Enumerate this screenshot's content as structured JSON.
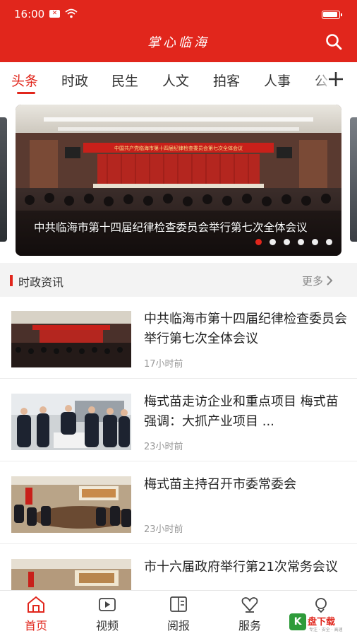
{
  "status_bar": {
    "time": "16:00"
  },
  "app": {
    "title": "掌心临海"
  },
  "tabs": [
    {
      "label": "头条",
      "active": true
    },
    {
      "label": "时政"
    },
    {
      "label": "民生"
    },
    {
      "label": "人文"
    },
    {
      "label": "拍客"
    },
    {
      "label": "人事"
    },
    {
      "label": "公"
    }
  ],
  "carousel": {
    "caption": "中共临海市第十四届纪律检查委员会举行第七次全体会议",
    "banner_text": "中国共产党临海市第十四届纪律检查委员会第七次全体会议",
    "slide_count": 6,
    "active_index": 0
  },
  "section": {
    "title": "时政资讯",
    "more_label": "更多"
  },
  "news": [
    {
      "title": "中共临海市第十四届纪律检查委员会举行第七次全体会议",
      "time": "17小时前"
    },
    {
      "title": "梅式苗走访企业和重点项目 梅式苗强调：大抓产业项目 ...",
      "time": "23小时前"
    },
    {
      "title": "梅式苗主持召开市委常委会",
      "time": "23小时前"
    },
    {
      "title": "市十六届政府举行第21次常务会议",
      "time": ""
    }
  ],
  "bottom_nav": [
    {
      "label": "首页",
      "icon": "home-icon",
      "active": true
    },
    {
      "label": "视频",
      "icon": "video-icon"
    },
    {
      "label": "阅报",
      "icon": "newspaper-icon"
    },
    {
      "label": "服务",
      "icon": "service-icon"
    },
    {
      "label": "",
      "icon": "chat-icon"
    }
  ],
  "watermark": {
    "brand": "盘下载",
    "sub": "专注 · 安全 · 高速"
  },
  "colors": {
    "accent": "#e1261c"
  }
}
